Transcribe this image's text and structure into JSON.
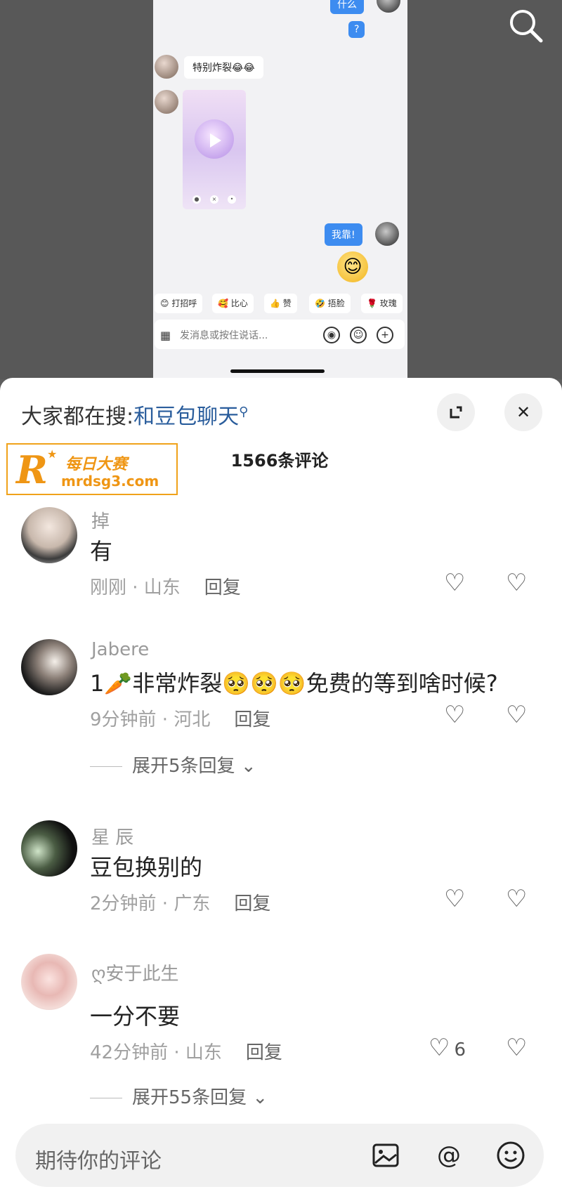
{
  "video": {
    "chat_top_bubble": "什么",
    "chat_question": "?",
    "chat_in_text": "特别炸裂😂😂",
    "chat_out_text": "我靠!",
    "big_emoji": "😊",
    "quick_chips": [
      "😊 打招呼",
      "🥰 比心",
      "👍 赞",
      "🤣 捂脸",
      "🌹 玫瑰"
    ],
    "input_placeholder": "发消息或按住说话..."
  },
  "sheet": {
    "search_prefix": "大家都在搜:",
    "search_term": "和豆包聊天",
    "comment_count": "1566条评论"
  },
  "watermark": {
    "brand_cn": "每日大赛",
    "url": "mrdsg3.com"
  },
  "comments": [
    {
      "name": "掉",
      "text": "有",
      "meta": "刚刚 · 山东",
      "reply": "回复",
      "likes": ""
    },
    {
      "name": "Jabere",
      "text": "1🥕非常炸裂🥺🥺🥺免费的等到啥时候?",
      "meta": "9分钟前 · 河北",
      "reply": "回复",
      "likes": "",
      "expand": "展开5条回复"
    },
    {
      "name": "星 辰",
      "text": "豆包换别的",
      "meta": "2分钟前 · 广东",
      "reply": "回复",
      "likes": ""
    },
    {
      "name": "ღ安于此生",
      "text": "一分不要",
      "meta": "42分钟前 · 山东",
      "reply": "回复",
      "likes": "6",
      "expand": "展开55条回复"
    }
  ],
  "bottom": {
    "placeholder": "期待你的评论"
  }
}
